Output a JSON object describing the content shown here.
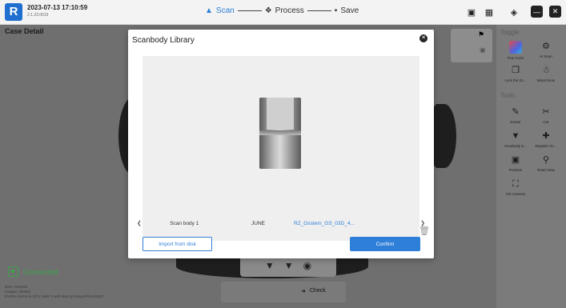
{
  "topbar": {
    "datetime": "2023-07-13 17:10:59",
    "version": "2.1.23.0619",
    "steps": [
      {
        "label": "Scan",
        "icon": "scan-icon",
        "active": true
      },
      {
        "label": "Process",
        "icon": "process-icon",
        "active": false
      },
      {
        "label": "Save",
        "icon": "save-icon",
        "active": false
      }
    ]
  },
  "page": {
    "title": "Case Detail",
    "connection_status": "Connected",
    "sysinfo": [
      "Bore: RX2020",
      "Images: 250401",
      "NVIDIA GeForce GTX 1660 Ti with Max-Q Design/PCIe/SSE2"
    ],
    "check_label": "Check"
  },
  "right_panel": {
    "toggle_title": "Toggle",
    "toggle_items": [
      {
        "label": "True Color",
        "icon": "true-color-icon"
      },
      {
        "label": "AI Scan",
        "icon": "ai-scan-icon"
      },
      {
        "label": "Lock the Sc...",
        "icon": "lock-scan-icon"
      },
      {
        "label": "Metal Scan",
        "icon": "metal-scan-icon"
      }
    ],
    "tools_title": "Tools",
    "tool_items": [
      {
        "label": "Eraser",
        "icon": "eraser-icon"
      },
      {
        "label": "Cut",
        "icon": "cut-icon"
      },
      {
        "label": "Scanbody S...",
        "icon": "scanbody-select-icon"
      },
      {
        "label": "Register Sc...",
        "icon": "register-scanbody-icon"
      },
      {
        "label": "Preview",
        "icon": "preview-icon"
      },
      {
        "label": "Read View",
        "icon": "read-view-icon"
      },
      {
        "label": "HD Camera",
        "icon": "hd-camera-icon"
      }
    ]
  },
  "modal": {
    "title": "Scanbody Library",
    "library_items": [
      "Scan body 1",
      "JUNE",
      "RZ_Osstem_GS_03D_4...",
      ""
    ],
    "selected_index": 2,
    "import_label": "Import from disk",
    "confirm_label": "Confirm"
  },
  "colors": {
    "accent": "#2d7fd8",
    "connected": "#3da34a"
  }
}
